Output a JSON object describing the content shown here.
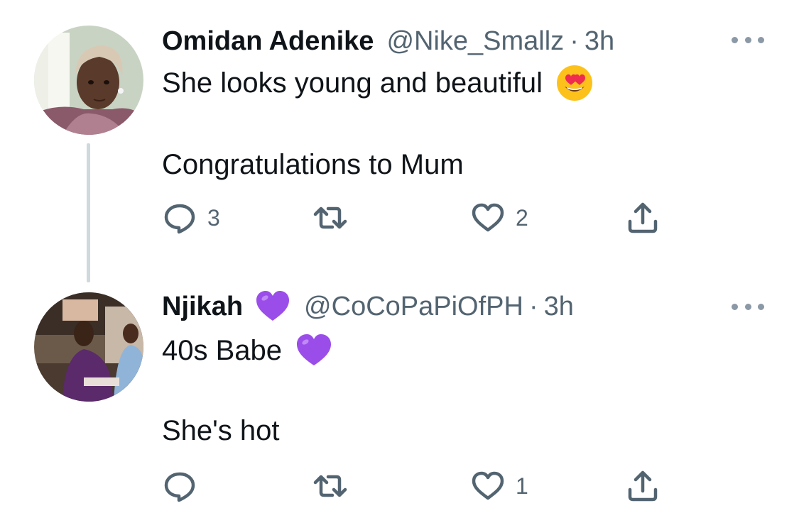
{
  "tweets": [
    {
      "display_name": "Omidan Adenike",
      "handle": "@Nike_Smallz",
      "separator": "·",
      "time": "3h",
      "lines": [
        "She looks young and beautiful",
        "Congratulations to Mum"
      ],
      "line1_emoji": "heart-eyes-emoji",
      "replies": "3",
      "retweets": "",
      "likes": "2"
    },
    {
      "display_name": "Njikah",
      "name_emoji": "purple-heart-emoji",
      "handle": "@CoCoPaPiOfPH",
      "separator": "·",
      "time": "3h",
      "lines": [
        "40s Babe",
        "She's hot"
      ],
      "line1_emoji": "purple-heart-emoji",
      "replies": "",
      "retweets": "",
      "likes": "1"
    }
  ],
  "colors": {
    "text_primary": "#0f1419",
    "text_secondary": "#536471",
    "thread_line": "#cfd9de",
    "purple_heart": "#9b4dea"
  }
}
